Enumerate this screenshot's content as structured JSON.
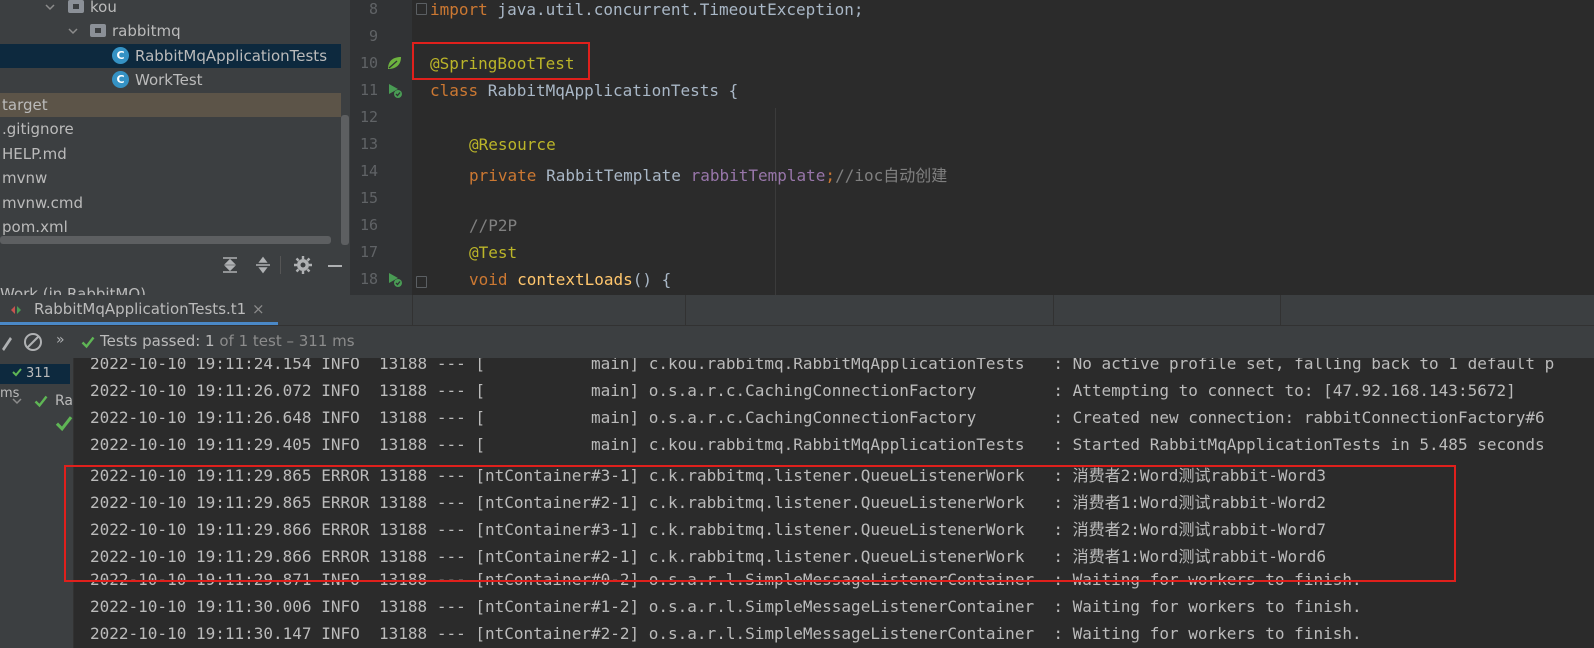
{
  "project_tree": {
    "rows": [
      {
        "label": "kou",
        "type": "folder",
        "expanded": true
      },
      {
        "label": "rabbitmq",
        "type": "folder",
        "expanded": true
      },
      {
        "label": "RabbitMqApplicationTests",
        "type": "class",
        "selected": true
      },
      {
        "label": "WorkTest",
        "type": "class"
      },
      {
        "label": "target",
        "type": "folder-excluded"
      },
      {
        "label": ".gitignore",
        "type": "file"
      },
      {
        "label": "HELP.md",
        "type": "file"
      },
      {
        "label": "mvnw",
        "type": "file"
      },
      {
        "label": "mvnw.cmd",
        "type": "file"
      },
      {
        "label": "pom.xml",
        "type": "file"
      }
    ],
    "toolbar_icons": [
      "expand-all-icon",
      "collapse-all-icon",
      "gear-icon",
      "minimize-icon"
    ],
    "cut_off_label": "Work (in RabbitMQ)"
  },
  "editor": {
    "lines": [
      {
        "number": "8",
        "text": "import java.util.concurrent.TimeoutException;"
      },
      {
        "number": "9",
        "text": ""
      },
      {
        "number": "10",
        "text": "@SpringBootTest",
        "gutter_icon": "spring-bean-icon"
      },
      {
        "number": "11",
        "text": "class RabbitMqApplicationTests {",
        "gutter_icon": "run-test-icon"
      },
      {
        "number": "12",
        "text": ""
      },
      {
        "number": "13",
        "text": "@Resource"
      },
      {
        "number": "14",
        "text": "private RabbitTemplate rabbitTemplate;//ioc自动创建"
      },
      {
        "number": "15",
        "text": ""
      },
      {
        "number": "16",
        "text": "//P2P"
      },
      {
        "number": "17",
        "text": "@Test"
      },
      {
        "number": "18",
        "text": "void contextLoads() {",
        "gutter_icon": "run-test-icon"
      }
    ],
    "tokens": {
      "import_kw": "import",
      "import_path": " java.util.concurrent.TimeoutException;",
      "annotation_main": "@SpringBootTest",
      "class_kw": "class",
      "class_name": " RabbitMqApplicationTests {",
      "annotation_resource": "@Resource",
      "private_kw": "private",
      "field_type": " RabbitTemplate ",
      "field_name": "rabbitTemplate",
      "semicolon": ";",
      "field_comment": "//ioc自动创建",
      "comment_p2p": "//P2P",
      "annotation_test": "@Test",
      "void_kw": "void",
      "method_name": " contextLoads",
      "method_tail": "() {"
    }
  },
  "run_window": {
    "tab_label": "RabbitMqApplicationTests.t1",
    "tab_close": "×",
    "tests_passed_label": "Tests passed: ",
    "tests_passed_count": "1",
    "tests_passed_detail": " of 1 test – 311 ms",
    "tree_time": "311 ms",
    "tree_row_label": "Ra",
    "more_glyph": "»",
    "colors": {
      "accent": "#4a88c7",
      "pass": "#5fb655",
      "highlight": "#e0201c"
    }
  },
  "console_lines": [
    {
      "date": "2022-10-10",
      "time": "19:11:24.154",
      "level": "INFO",
      "pid": "13188",
      "sep": "---",
      "thread": "[           main]",
      "logger": "c.kou.rabbitmq.RabbitMqApplicationTests  ",
      "message": ": No active profile set, falling back to 1 default p"
    },
    {
      "date": "2022-10-10",
      "time": "19:11:26.072",
      "level": "INFO",
      "pid": "13188",
      "sep": "---",
      "thread": "[           main]",
      "logger": "o.s.a.r.c.CachingConnectionFactory       ",
      "message": ": Attempting to connect to: [47.92.168.143:5672]"
    },
    {
      "date": "2022-10-10",
      "time": "19:11:26.648",
      "level": "INFO",
      "pid": "13188",
      "sep": "---",
      "thread": "[           main]",
      "logger": "o.s.a.r.c.CachingConnectionFactory       ",
      "message": ": Created new connection: rabbitConnectionFactory#6"
    },
    {
      "date": "2022-10-10",
      "time": "19:11:29.405",
      "level": "INFO",
      "pid": "13188",
      "sep": "---",
      "thread": "[           main]",
      "logger": "c.kou.rabbitmq.RabbitMqApplicationTests  ",
      "message": ": Started RabbitMqApplicationTests in 5.485 seconds"
    },
    {
      "date": "2022-10-10",
      "time": "19:11:29.865",
      "level": "ERROR",
      "pid": "13188",
      "sep": "---",
      "thread": "[ntContainer#3-1]",
      "logger": "c.k.rabbitmq.listener.QueueListenerWork  ",
      "message": ": 消费者2:Word测试rabbit-Word3"
    },
    {
      "date": "2022-10-10",
      "time": "19:11:29.865",
      "level": "ERROR",
      "pid": "13188",
      "sep": "---",
      "thread": "[ntContainer#2-1]",
      "logger": "c.k.rabbitmq.listener.QueueListenerWork  ",
      "message": ": 消费者1:Word测试rabbit-Word2"
    },
    {
      "date": "2022-10-10",
      "time": "19:11:29.866",
      "level": "ERROR",
      "pid": "13188",
      "sep": "---",
      "thread": "[ntContainer#3-1]",
      "logger": "c.k.rabbitmq.listener.QueueListenerWork  ",
      "message": ": 消费者2:Word测试rabbit-Word7"
    },
    {
      "date": "2022-10-10",
      "time": "19:11:29.866",
      "level": "ERROR",
      "pid": "13188",
      "sep": "---",
      "thread": "[ntContainer#2-1]",
      "logger": "c.k.rabbitmq.listener.QueueListenerWork  ",
      "message": ": 消费者1:Word测试rabbit-Word6"
    },
    {
      "date": "2022-10-10",
      "time": "19:11:29.871",
      "level": "INFO",
      "pid": "13188",
      "sep": "---",
      "thread": "[ntContainer#0-2]",
      "logger": "o.s.a.r.l.SimpleMessageListenerContainer ",
      "message": ": Waiting for workers to finish."
    },
    {
      "date": "2022-10-10",
      "time": "19:11:30.006",
      "level": "INFO",
      "pid": "13188",
      "sep": "---",
      "thread": "[ntContainer#1-2]",
      "logger": "o.s.a.r.l.SimpleMessageListenerContainer ",
      "message": ": Waiting for workers to finish."
    },
    {
      "date": "2022-10-10",
      "time": "19:11:30.147",
      "level": "INFO",
      "pid": "13188",
      "sep": "---",
      "thread": "[ntContainer#2-2]",
      "logger": "o.s.a.r.l.SimpleMessageListenerContainer ",
      "message": ": Waiting for workers to finish."
    }
  ]
}
